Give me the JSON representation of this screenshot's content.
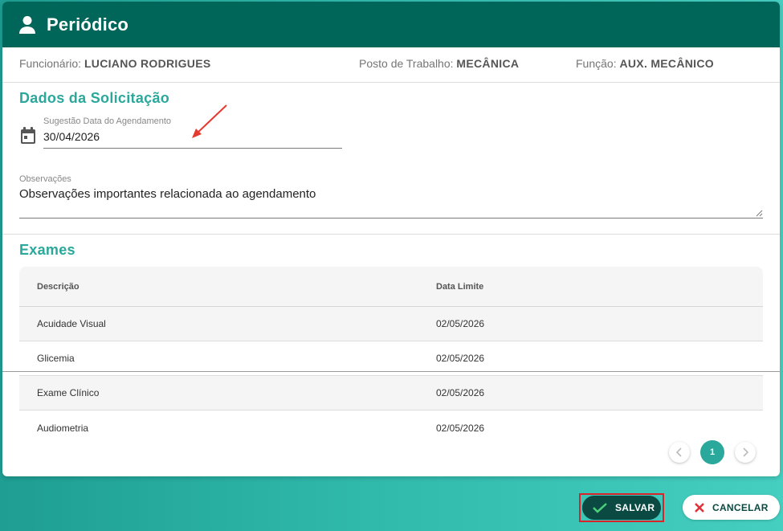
{
  "header": {
    "title": "Periódico",
    "icon": "user-icon"
  },
  "info": {
    "employee_label": "Funcionário:",
    "employee_value": "LUCIANO RODRIGUES",
    "workstation_label": "Posto de Trabalho:",
    "workstation_value": "MECÂNICA",
    "role_label": "Função:",
    "role_value": "AUX. MECÂNICO"
  },
  "request": {
    "section_title": "Dados da Solicitação",
    "date_label": "Sugestão Data do Agendamento",
    "date_value": "30/04/2026",
    "notes_label": "Observações",
    "notes_value": "Observações importantes relacionada ao agendamento"
  },
  "exams": {
    "section_title": "Exames",
    "columns": [
      "Descrição",
      "Data Limite"
    ],
    "rows": [
      {
        "description": "Acuidade Visual",
        "deadline": "02/05/2026"
      },
      {
        "description": "Glicemia",
        "deadline": "02/05/2026"
      },
      {
        "description": "Exame Clínico",
        "deadline": "02/05/2026"
      },
      {
        "description": "Audiometria",
        "deadline": "02/05/2026"
      }
    ]
  },
  "pagination": {
    "current_page": "1"
  },
  "actions": {
    "save_label": "SALVAR",
    "cancel_label": "CANCELAR"
  },
  "colors": {
    "header": "#006659",
    "accent": "#2aa89b",
    "save": "#0a4a42",
    "highlight": "#d9232a"
  }
}
